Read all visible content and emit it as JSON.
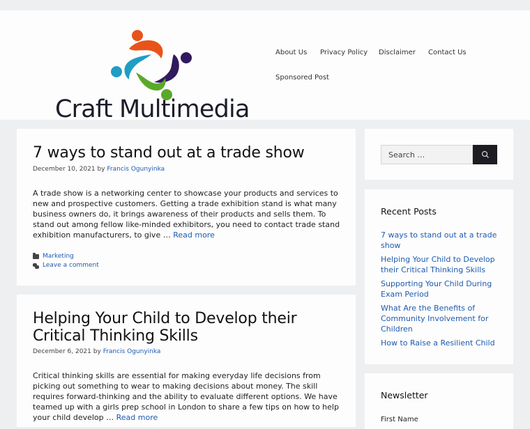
{
  "site": {
    "title": "Craft Multimedia",
    "logo_colors": [
      "#e8531a",
      "#1f9dc4",
      "#311a5e",
      "#5aa928"
    ]
  },
  "nav": {
    "items": [
      {
        "label": "About Us"
      },
      {
        "label": "Privacy Policy"
      },
      {
        "label": "Disclaimer"
      },
      {
        "label": "Contact Us"
      },
      {
        "label": "Sponsored Post"
      }
    ]
  },
  "posts": [
    {
      "title": "7 ways to stand out at a trade show",
      "date": "December 10, 2021",
      "by": "by",
      "author": "Francis Ogunyinka",
      "excerpt": "A trade show is a networking center to showcase your products and services to new and prospective customers. Getting a trade exhibition stand is what many business owners do, it brings awareness of their products and sells them. To stand out among fellow like-minded exhibitors, you need to contact trade stand exhibition manufacturers, to give … ",
      "read_more": "Read more",
      "category": "Marketing",
      "comments": "Leave a comment"
    },
    {
      "title": "Helping Your Child to Develop their Critical Thinking Skills",
      "date": "December 6, 2021",
      "by": "by",
      "author": "Francis Ogunyinka",
      "excerpt": "Critical thinking skills are essential for making everyday life decisions from picking out something to wear to making decisions about money. The skill requires forward-thinking and the ability to evaluate different options. We have teamed up with a girls prep school in London to share a few tips on how to help your child develop … ",
      "read_more": "Read more"
    }
  ],
  "sidebar": {
    "search": {
      "placeholder": "Search …",
      "button_icon": "search-icon"
    },
    "recent_posts": {
      "title": "Recent Posts",
      "items": [
        {
          "label": "7 ways to stand out at a trade show"
        },
        {
          "label": "Helping Your Child to Develop their Critical Thinking Skills"
        },
        {
          "label": "Supporting Your Child During Exam Period"
        },
        {
          "label": "What Are the Benefits of Community Involvement for Children"
        },
        {
          "label": "How to Raise a Resilient Child"
        }
      ]
    },
    "newsletter": {
      "title": "Newsletter",
      "first_field_label": "First Name"
    }
  },
  "colors": {
    "link": "#1e5bb0",
    "background": "#eeeff1",
    "search_button": "#1d1c23"
  }
}
